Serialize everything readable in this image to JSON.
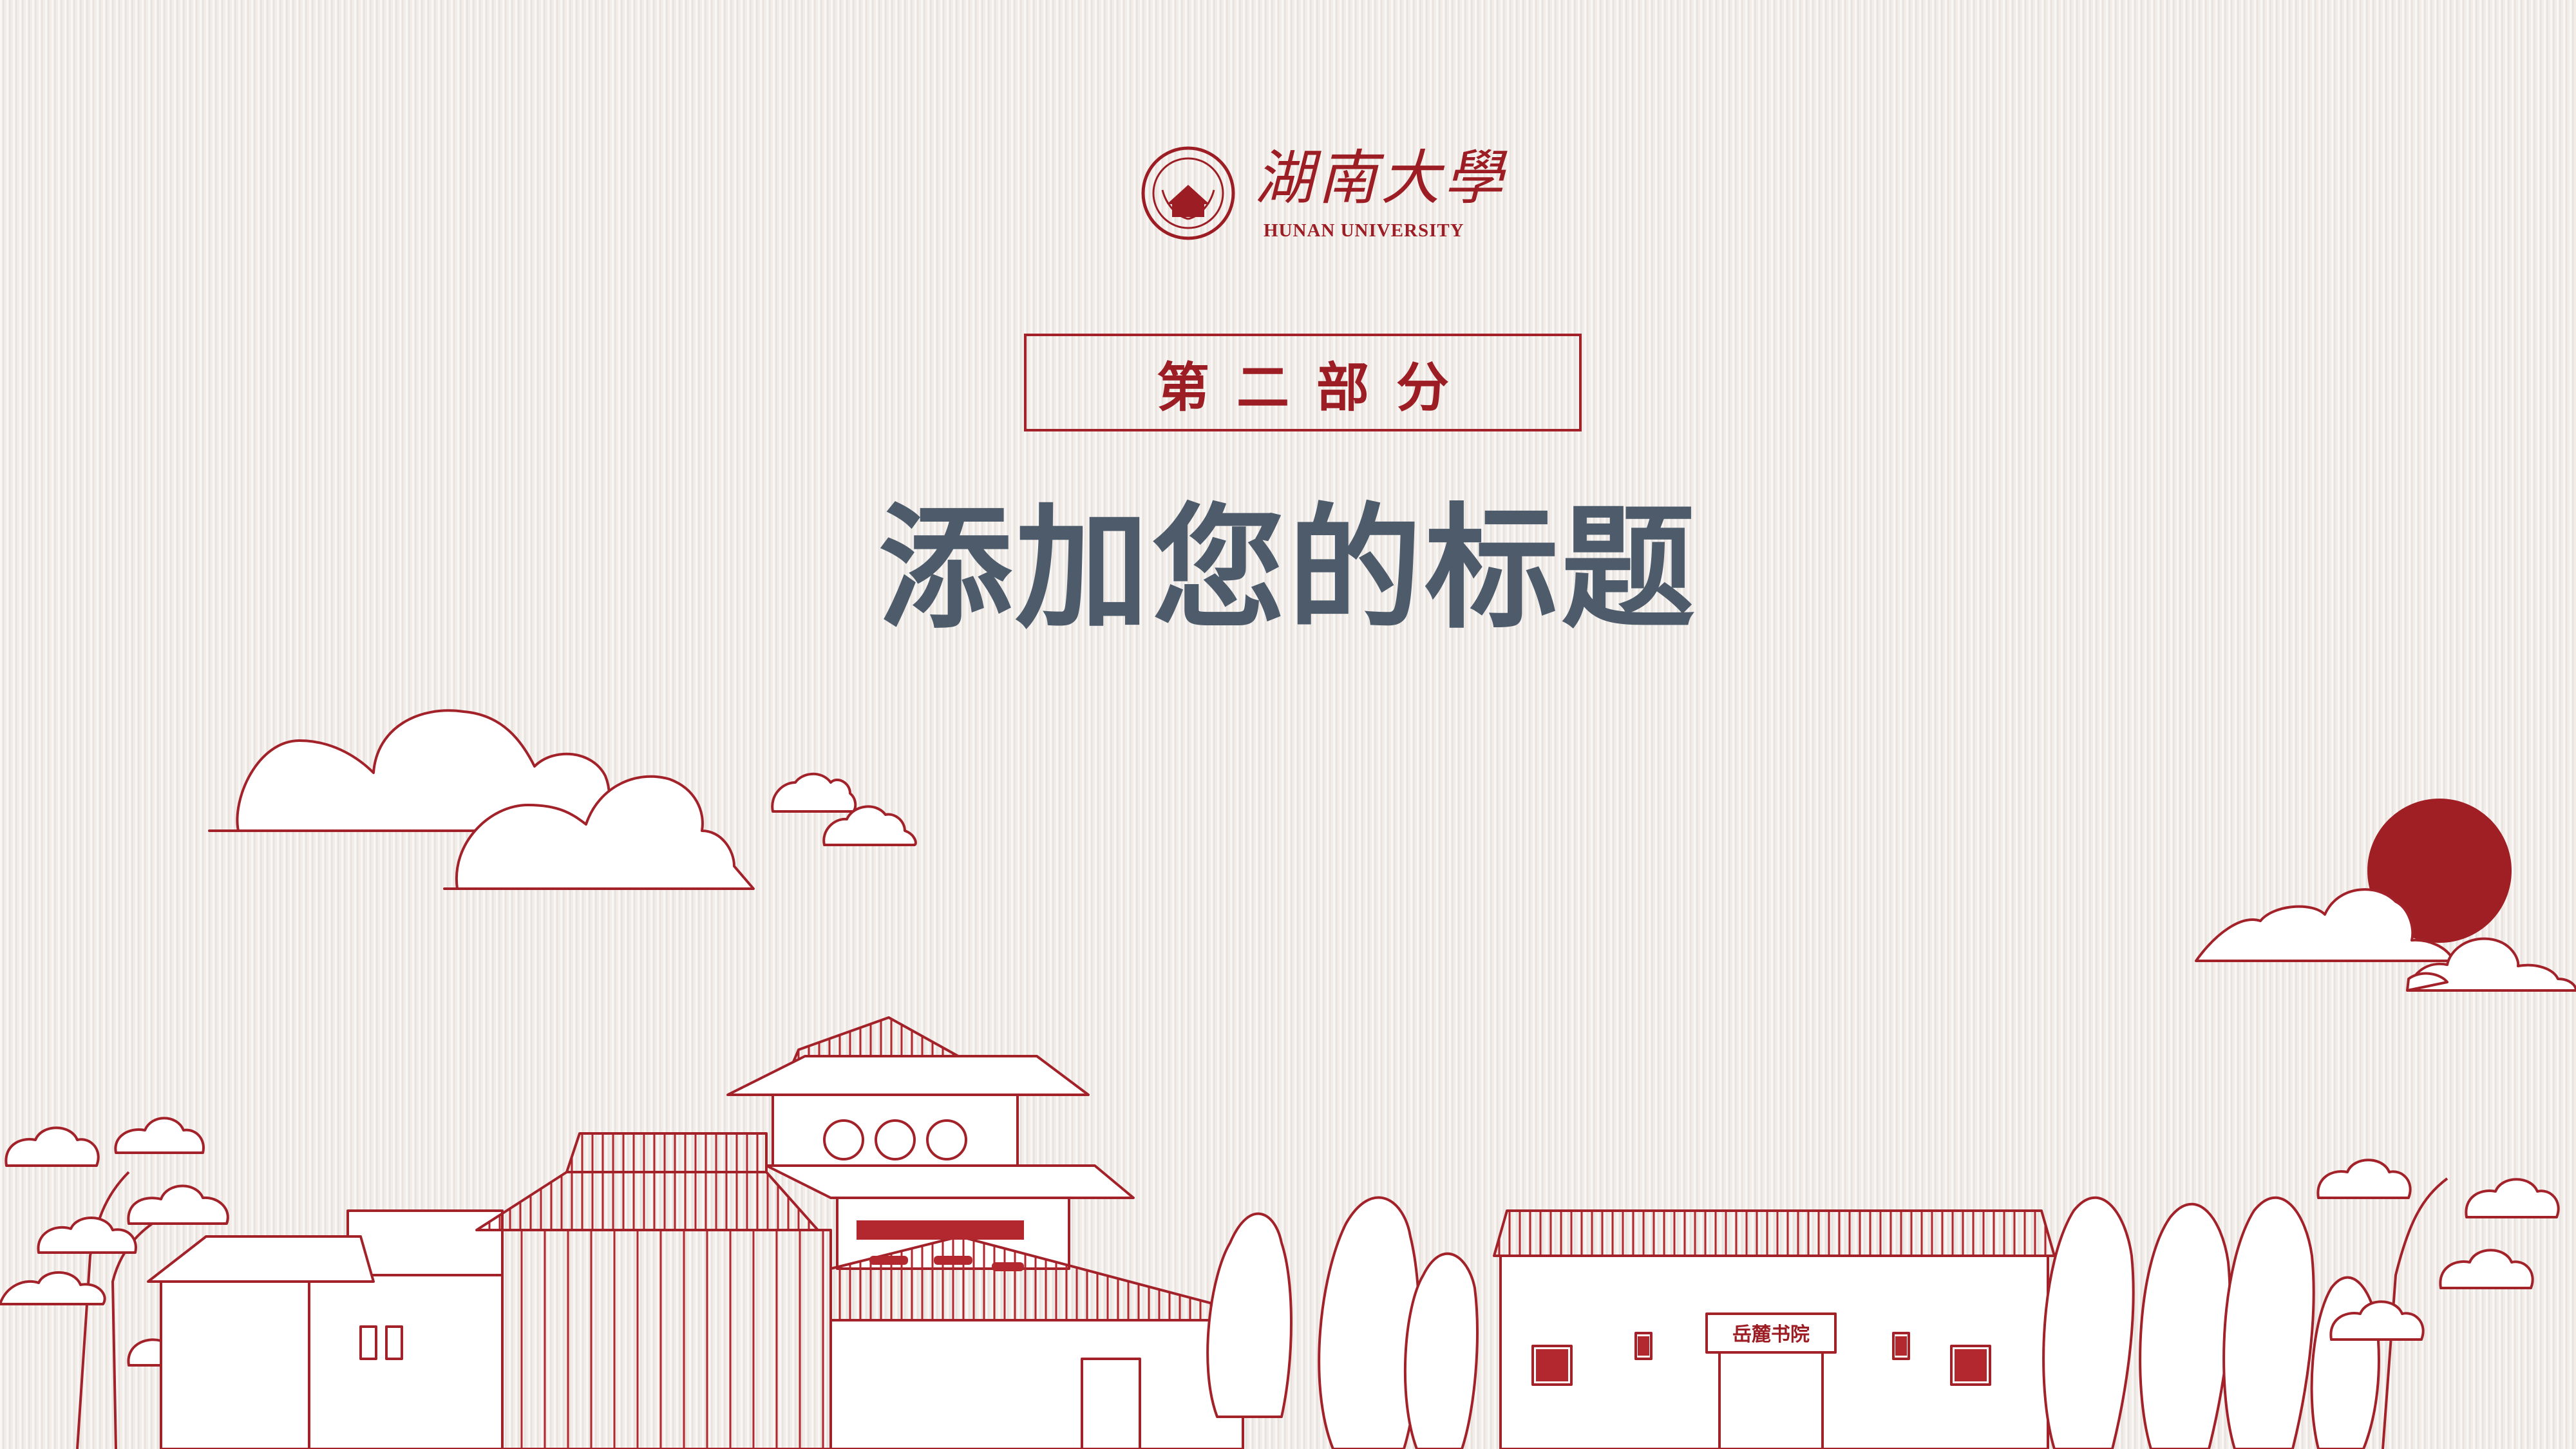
{
  "logo": {
    "calligraphy": "湖南大學",
    "english": "HUNAN UNIVERSITY",
    "seal_text": "湖南大学"
  },
  "section_label": "第二部分",
  "title": "添加您的标题",
  "plaque": "岳麓书院",
  "colors": {
    "accent_red": "#9c1d23",
    "title_gray": "#4d5b6b",
    "background": "#f2ede9"
  }
}
